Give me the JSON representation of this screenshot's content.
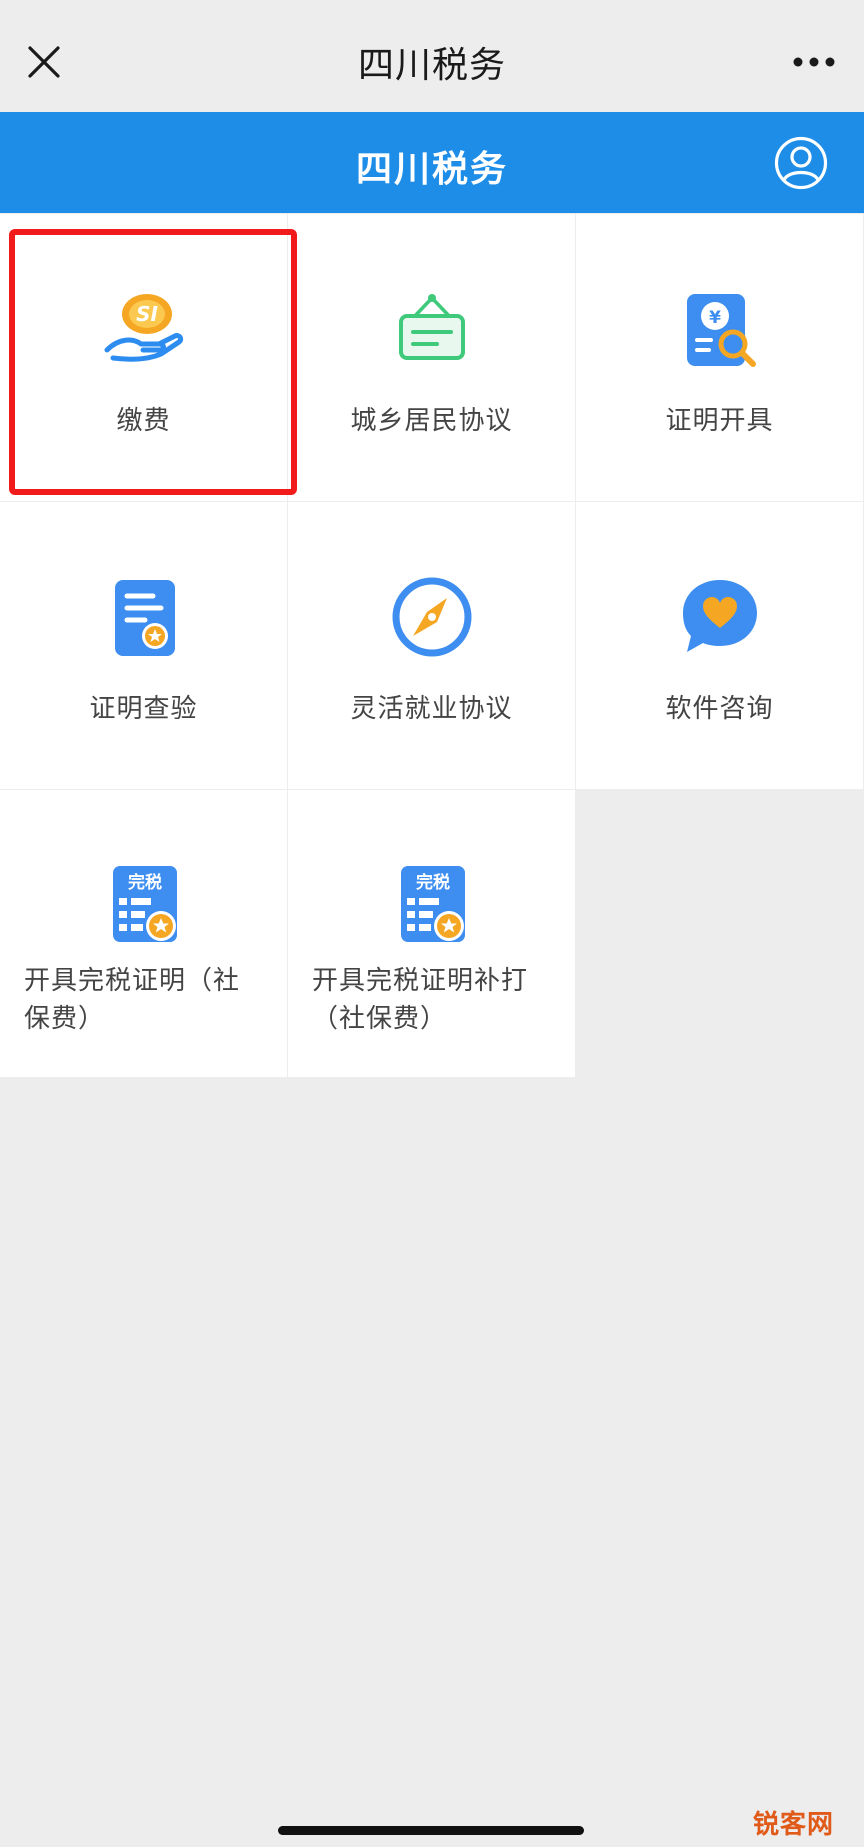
{
  "nav": {
    "title": "四川税务",
    "close_icon": "close-icon",
    "more_icon": "more-icon"
  },
  "header": {
    "title": "四川税务",
    "user_icon": "user-icon",
    "color": "#1d8de8"
  },
  "grid": {
    "items": [
      {
        "label": "缴费",
        "icon": "social-insurance-hand-icon"
      },
      {
        "label": "城乡居民协议",
        "icon": "hanging-sign-icon"
      },
      {
        "label": "证明开具",
        "icon": "document-search-icon"
      },
      {
        "label": "证明查验",
        "icon": "document-star-icon"
      },
      {
        "label": "灵活就业协议",
        "icon": "compass-icon"
      },
      {
        "label": "软件咨询",
        "icon": "chat-heart-icon"
      },
      {
        "label": "开具完税证明（社保费）",
        "line1": "开具完税证明（社",
        "line2": "保费）",
        "icon_text": "完税",
        "icon": "tax-certificate-icon"
      },
      {
        "label": "开具完税证明补打（社保费）",
        "line1": "开具完税证明补打",
        "line2": "（社保费）",
        "icon_text": "完税",
        "icon": "tax-certificate-reprint-icon"
      }
    ],
    "highlight_color": "#f11b1b"
  },
  "watermark": "锐客网"
}
